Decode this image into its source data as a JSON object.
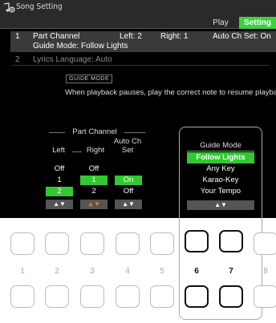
{
  "header": {
    "title": "Song Setting",
    "tabs": [
      {
        "label": "Play",
        "selected": false
      },
      {
        "label": "Setting",
        "selected": true
      }
    ],
    "accent_color": "#3fcf3f"
  },
  "settings": {
    "row1": {
      "number": "1",
      "label": "Part Channel",
      "left": "Left: 2",
      "right": "Right: 1",
      "auto": "Auto Ch Set: On",
      "guide": "Guide Mode: Follow Lights"
    },
    "row2": {
      "number": "2",
      "label": "Lyrics Language: Auto"
    }
  },
  "guide_info": {
    "tag": "GUIDE MODE",
    "description": "When playback pauses, play the correct note to resume playback."
  },
  "part_channel": {
    "title": "Part Channel",
    "col_left": "Left",
    "col_right": "Right",
    "col_auto_1": "Auto Ch",
    "col_auto_2": "Set",
    "left_values": [
      "Off",
      "1",
      "2"
    ],
    "right_values": [
      "Off",
      "1",
      "2"
    ],
    "auto_values": [
      "On",
      "Off"
    ],
    "left_selected": "2",
    "right_selected": "1",
    "auto_selected": "On",
    "arrow": "▲▼"
  },
  "guide_mode": {
    "title": "Guide Mode",
    "options": [
      "Follow Lights",
      "Any Key",
      "Karao-Key",
      "Your Tempo"
    ],
    "selected": "Follow Lights",
    "arrow": "▲▼"
  },
  "panel_buttons": {
    "numbers": [
      "1",
      "2",
      "3",
      "4",
      "5",
      "6",
      "7",
      "8"
    ],
    "highlighted": [
      "6",
      "7"
    ]
  }
}
